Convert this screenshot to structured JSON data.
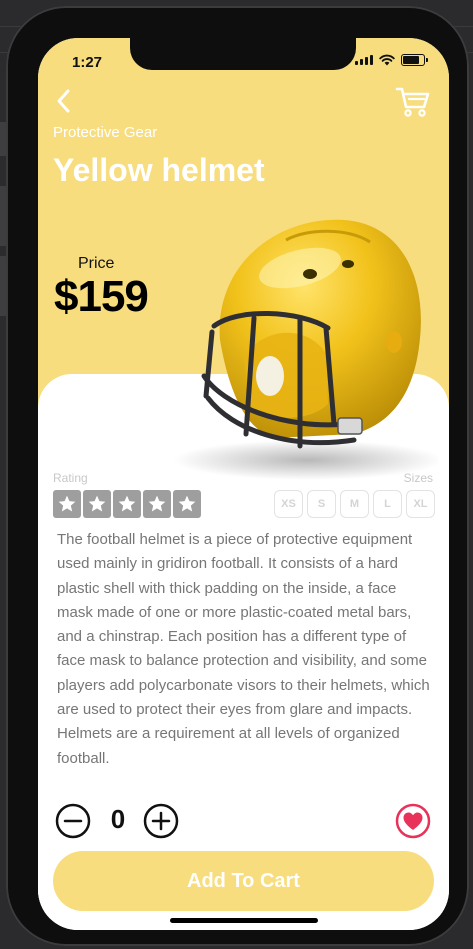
{
  "status_bar": {
    "time": "1:27"
  },
  "header": {
    "back_icon": "chevron-left-icon",
    "cart_icon": "cart-icon",
    "category": "Protective Gear",
    "title": "Yellow helmet"
  },
  "price": {
    "label": "Price",
    "value": "$159"
  },
  "product_image": "football-helmet-image",
  "rating": {
    "label": "Rating",
    "stars": 5,
    "max_stars": 5
  },
  "sizes": {
    "label": "Sizes",
    "options": [
      "XS",
      "S",
      "M",
      "L",
      "XL"
    ]
  },
  "description": "The football helmet is a piece of protective equipment used mainly in gridiron football. It consists of a hard plastic shell with thick padding on the inside, a face mask made of one or more plastic-coated metal bars, and a chinstrap. Each position has a different type of face mask to balance protection and visibility, and some players add polycarbonate visors to their helmets, which are used to protect their eyes from glare and impacts. Helmets are a requirement at all levels of organized football.",
  "quantity": {
    "value": "0",
    "minus_icon": "minus-circle-icon",
    "plus_icon": "plus-circle-icon"
  },
  "favorite": {
    "icon": "heart-icon",
    "color": "#e8325a"
  },
  "add_to_cart": {
    "label": "Add To Cart"
  },
  "colors": {
    "accent": "#f7dd7d",
    "star": "#9e9e9e",
    "text_muted": "#767676"
  }
}
